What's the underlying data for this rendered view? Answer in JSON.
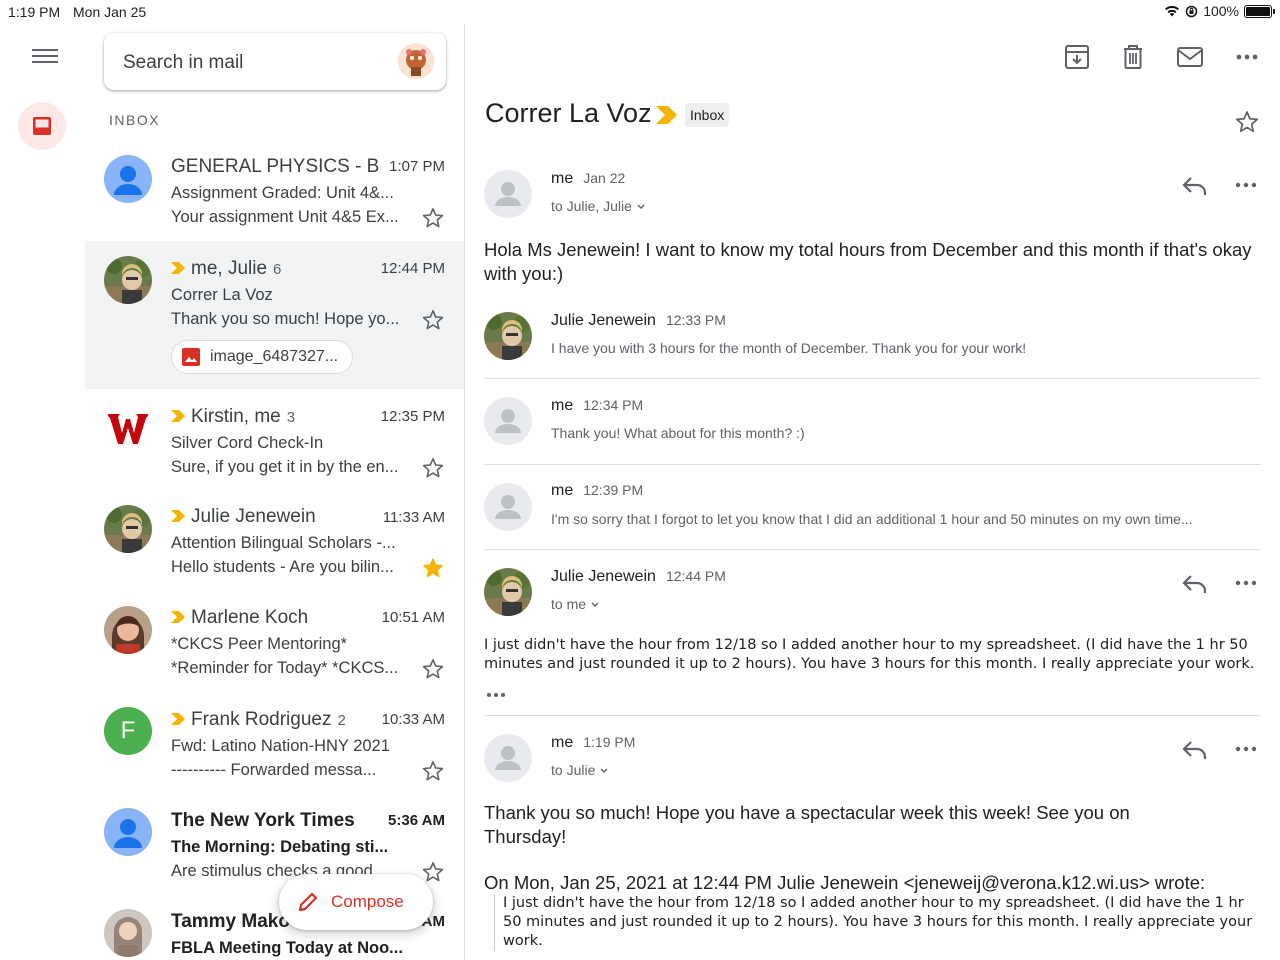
{
  "status": {
    "time": "1:19 PM",
    "date": "Mon Jan 25",
    "battery": "100%"
  },
  "search": {
    "placeholder": "Search in mail"
  },
  "inbox_label": "INBOX",
  "compose_label": "Compose",
  "colors": {
    "accent_red": "#d93025",
    "important_yellow": "#f5b400",
    "selected_bg": "#f1f3f4"
  },
  "emails": [
    {
      "sender": "GENERAL PHYSICS - B...",
      "count": "",
      "time": "1:07 PM",
      "subject": "Assignment Graded: Unit 4&...",
      "snippet": "Your assignment Unit 4&5 Ex...",
      "starred": false,
      "unread": false,
      "important": false
    },
    {
      "sender": "me, Julie",
      "count": "6",
      "time": "12:44 PM",
      "subject": "Correr La Voz",
      "snippet": "Thank you so much! Hope yo...",
      "attachment": "image_6487327...",
      "starred": false,
      "unread": false,
      "important": true
    },
    {
      "sender": "Kirstin, me",
      "count": "3",
      "time": "12:35 PM",
      "subject": "Silver Cord Check-In",
      "snippet": "Sure, if you get it in by the en...",
      "starred": false,
      "unread": false,
      "important": true
    },
    {
      "sender": "Julie Jenewein",
      "count": "",
      "time": "11:33 AM",
      "subject": "Attention Bilingual Scholars -...",
      "snippet": "Hello students - Are you bilin...",
      "starred": true,
      "unread": false,
      "important": true
    },
    {
      "sender": "Marlene Koch",
      "count": "",
      "time": "10:51 AM",
      "subject": "*CKCS Peer Mentoring*",
      "snippet": "*Reminder for Today* *CKCS...",
      "starred": false,
      "unread": false,
      "important": true
    },
    {
      "sender": "Frank Rodriguez",
      "count": "2",
      "time": "10:33 AM",
      "subject": "Fwd: Latino Nation-HNY 2021",
      "snippet": "---------- Forwarded messa...",
      "starred": false,
      "unread": false,
      "important": true,
      "avatar_letter": "F"
    },
    {
      "sender": "The New York Times",
      "count": "",
      "time": "5:36 AM",
      "subject": "The Morning: Debating sti...",
      "snippet": "Are stimulus checks a good...",
      "starred": false,
      "unread": true,
      "important": false
    },
    {
      "sender": "Tammy Mako",
      "count": "",
      "time": "AM",
      "subject": "FBLA Meeting Today at Noo...",
      "snippet": "",
      "starred": false,
      "unread": true,
      "important": false
    }
  ],
  "thread": {
    "title": "Correr La Voz",
    "label": "Inbox",
    "messages": [
      {
        "from": "me",
        "time": "Jan 22",
        "to": "to Julie, Julie",
        "body": "Hola Ms Jenewein! I want to know my total hours from December and this month if that's okay with you:)"
      },
      {
        "from": "Julie Jenewein",
        "time": "12:33 PM",
        "snippet": "I have you with 3 hours for the month of December. Thank you for your work!"
      },
      {
        "from": "me",
        "time": "12:34 PM",
        "snippet": "Thank you! What about for this month? :)"
      },
      {
        "from": "me",
        "time": "12:39 PM",
        "snippet": "I'm so sorry that I forgot to let you know that I did an additional 1 hour and 50 minutes on my own time..."
      },
      {
        "from": "Julie Jenewein",
        "time": "12:44 PM",
        "to": "to me",
        "body": "I just didn't have the hour from 12/18 so I added another hour to my spreadsheet. (I did have the 1 hr 50 minutes and just rounded it up to 2 hours). You have 3 hours for this month. I really appreciate your work."
      },
      {
        "from": "me",
        "time": "1:19 PM",
        "to": "to Julie",
        "body": "Thank you so much! Hope you have a spectacular week this week! See you on Thursday!",
        "quote_header": "On Mon, Jan 25, 2021 at 12:44 PM Julie Jenewein <jeneweij@verona.k12.wi.us> wrote:",
        "quote": "I just didn't have the hour from 12/18 so I added another hour to my spreadsheet. (I did have the 1 hr 50 minutes and just rounded it up to 2 hours). You have 3 hours for this month. I really appreciate your work."
      }
    ]
  }
}
